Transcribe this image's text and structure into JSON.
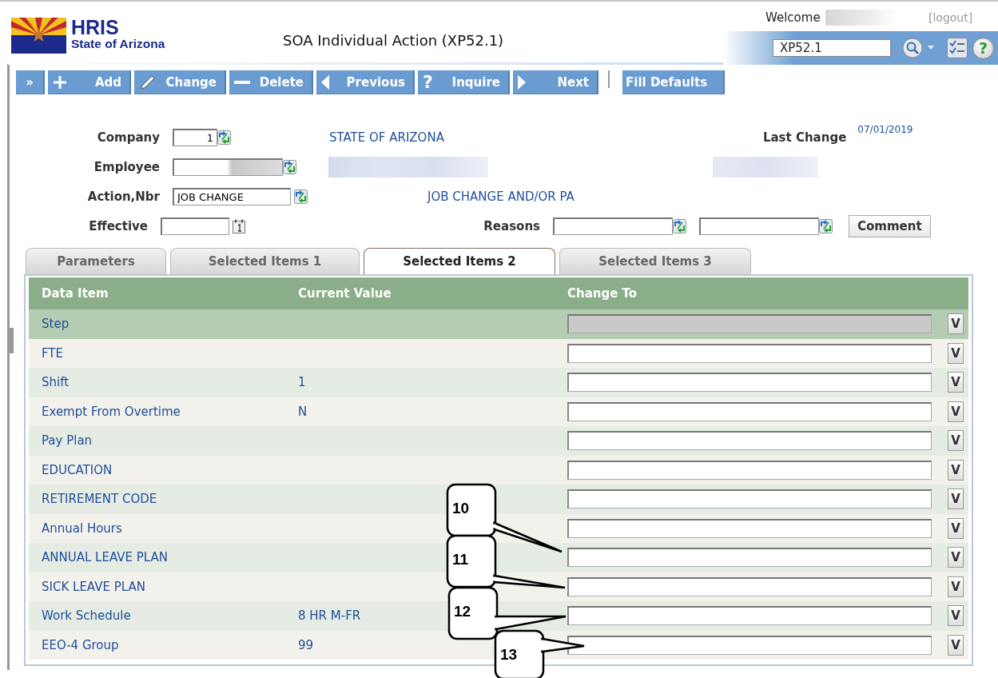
{
  "header": {
    "logo": {
      "line1": "HRIS",
      "line2": "State of Arizona"
    },
    "title": "SOA Individual Action (XP52.1)",
    "welcome": "Welcome",
    "logout": "[logout]",
    "search_value": "XP52.1",
    "help_glyph": "?"
  },
  "toolbar": [
    {
      "kind": "expand",
      "label": "»"
    },
    {
      "kind": "plus",
      "label": "Add"
    },
    {
      "kind": "pencil",
      "label": "Change"
    },
    {
      "kind": "minus",
      "label": "Delete"
    },
    {
      "kind": "prev",
      "label": "Previous"
    },
    {
      "kind": "help",
      "glyph": "?",
      "label": "Inquire"
    },
    {
      "kind": "next",
      "label": "Next"
    },
    {
      "kind": "dropdown",
      "label": "Fill Defaults"
    }
  ],
  "form": {
    "company": {
      "label": "Company",
      "value": "1",
      "description": "STATE OF ARIZONA"
    },
    "last_change": {
      "label": "Last Change",
      "value": "07/01/2019"
    },
    "employee": {
      "label": "Employee"
    },
    "action": {
      "label": "Action,Nbr",
      "value": "JOB CHANGE",
      "description": "JOB CHANGE AND/OR PA"
    },
    "effective": {
      "label": "Effective"
    },
    "reasons": {
      "label": "Reasons"
    },
    "comment_button": "Comment"
  },
  "tabs": [
    {
      "label": "Parameters",
      "selected": false
    },
    {
      "label": "Selected Items 1",
      "selected": false
    },
    {
      "label": "Selected Items 2",
      "selected": true
    },
    {
      "label": "Selected Items 3",
      "selected": false
    }
  ],
  "table": {
    "columns": [
      "Data Item",
      "Current Value",
      "Change To"
    ],
    "rows": [
      {
        "item": "Step",
        "current": "",
        "selected": true,
        "disabled": true,
        "button": "V"
      },
      {
        "item": "FTE",
        "current": "",
        "selected": false,
        "disabled": false,
        "button": "V"
      },
      {
        "item": "Shift",
        "current": "1",
        "selected": false,
        "disabled": false,
        "button": "V"
      },
      {
        "item": "Exempt From Overtime",
        "current": "N",
        "selected": false,
        "disabled": false,
        "button": "V"
      },
      {
        "item": "Pay Plan",
        "current": "",
        "selected": false,
        "disabled": false,
        "button": "V"
      },
      {
        "item": "EDUCATION",
        "current": "",
        "selected": false,
        "disabled": false,
        "button": "V"
      },
      {
        "item": "RETIREMENT CODE",
        "current": "",
        "selected": false,
        "disabled": false,
        "button": "V"
      },
      {
        "item": "Annual Hours",
        "current": "",
        "selected": false,
        "disabled": false,
        "button": "V"
      },
      {
        "item": "ANNUAL LEAVE PLAN",
        "current": "",
        "selected": false,
        "disabled": false,
        "button": "V"
      },
      {
        "item": "SICK LEAVE PLAN",
        "current": "",
        "selected": false,
        "disabled": false,
        "button": "V"
      },
      {
        "item": "Work Schedule",
        "current": "8 HR M-FR",
        "selected": false,
        "disabled": false,
        "button": "V"
      },
      {
        "item": "EEO-4 Group",
        "current": "99",
        "selected": false,
        "disabled": false,
        "button": "V"
      }
    ]
  },
  "callouts": [
    {
      "number": "10"
    },
    {
      "number": "11"
    },
    {
      "number": "12"
    },
    {
      "number": "13"
    }
  ]
}
